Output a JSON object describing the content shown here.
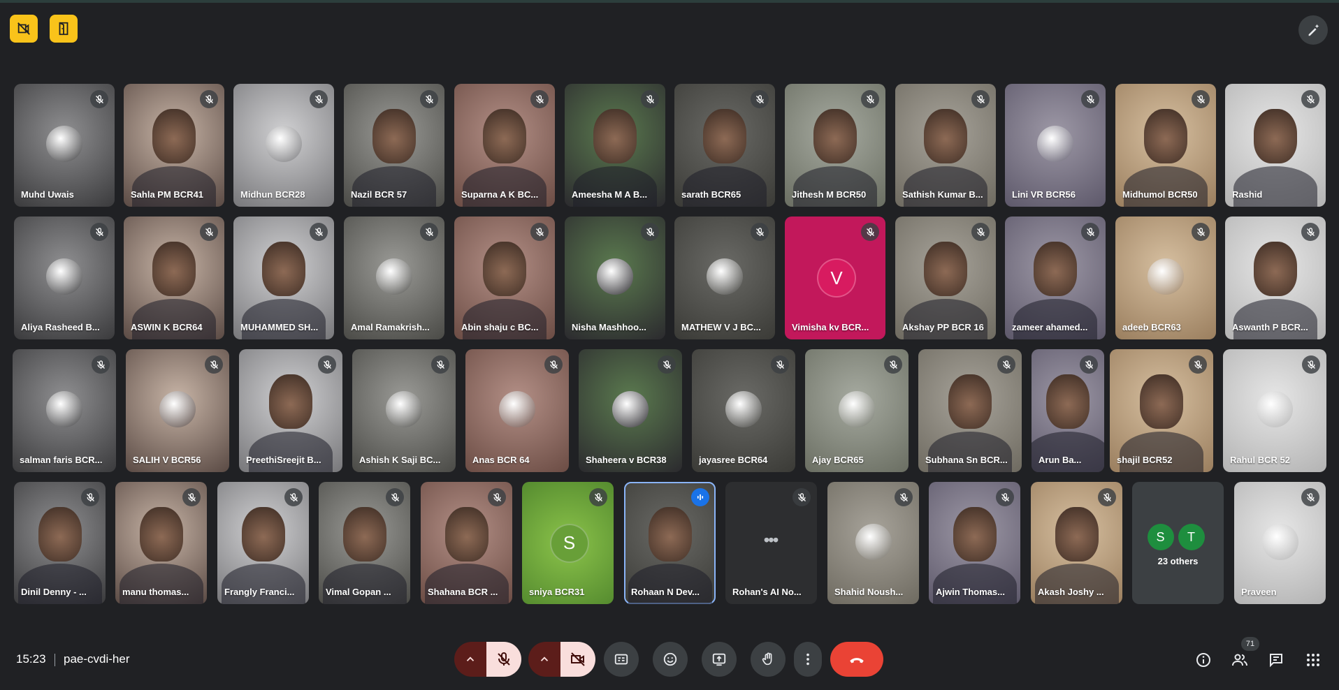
{
  "meeting": {
    "time": "15:23",
    "code": "pae-cvdi-her",
    "participant_count": "71"
  },
  "others_tile": {
    "initials": [
      "S",
      "T"
    ],
    "label": "23 others"
  },
  "colors": {
    "background": "#202124",
    "accent": "#f9c31a",
    "hangup": "#ea4335",
    "muted_red": "#f9dedc"
  },
  "participants": [
    {
      "name": "Muhd Uwais",
      "kind": "avatar"
    },
    {
      "name": "Sahla PM BCR41",
      "kind": "video"
    },
    {
      "name": "Midhun BCR28",
      "kind": "avatar"
    },
    {
      "name": "Nazil BCR 57",
      "kind": "video"
    },
    {
      "name": "Suparna A K BC...",
      "kind": "video"
    },
    {
      "name": "Ameesha M A B...",
      "kind": "video"
    },
    {
      "name": "sarath BCR65",
      "kind": "video"
    },
    {
      "name": "Jithesh M BCR50",
      "kind": "video"
    },
    {
      "name": "Sathish Kumar B...",
      "kind": "video"
    },
    {
      "name": "Lini VR BCR56",
      "kind": "avatar"
    },
    {
      "name": "Midhumol BCR50",
      "kind": "video"
    },
    {
      "name": "Rashid",
      "kind": "video"
    },
    {
      "name": "Aliya Rasheed B...",
      "kind": "avatar"
    },
    {
      "name": "ASWIN K BCR64",
      "kind": "video"
    },
    {
      "name": "MUHAMMED SH...",
      "kind": "video"
    },
    {
      "name": "Amal Ramakrish...",
      "kind": "avatar"
    },
    {
      "name": "Abin shaju c BC...",
      "kind": "video"
    },
    {
      "name": "Nisha Mashhoo...",
      "kind": "avatar"
    },
    {
      "name": "MATHEW V J BC...",
      "kind": "avatar"
    },
    {
      "name": "Vimisha kv BCR...",
      "kind": "letter",
      "letter": "V"
    },
    {
      "name": "Akshay PP BCR 16",
      "kind": "video"
    },
    {
      "name": "zameer ahamed...",
      "kind": "video"
    },
    {
      "name": "adeeb BCR63",
      "kind": "avatar"
    },
    {
      "name": "Aswanth P BCR...",
      "kind": "video"
    },
    {
      "name": "salman faris BCR...",
      "kind": "avatar"
    },
    {
      "name": "SALIH V BCR56",
      "kind": "avatar"
    },
    {
      "name": "PreethiSreejit B...",
      "kind": "video"
    },
    {
      "name": "Ashish K Saji BC...",
      "kind": "avatar"
    },
    {
      "name": "Anas BCR 64",
      "kind": "avatar"
    },
    {
      "name": "Shaheera v BCR38",
      "kind": "avatar"
    },
    {
      "name": "jayasree BCR64",
      "kind": "avatar"
    },
    {
      "name": "Ajay BCR65",
      "kind": "avatar"
    },
    {
      "name": "Subhana Sn BCR...",
      "kind": "video"
    },
    {
      "name": "Arun Ba...",
      "kind": "video"
    },
    {
      "name": "shajil BCR52",
      "kind": "video"
    },
    {
      "name": "Rahul BCR 52",
      "kind": "avatar"
    },
    {
      "name": "Dinil Denny - ...",
      "kind": "video"
    },
    {
      "name": "manu thomas...",
      "kind": "video"
    },
    {
      "name": "Frangly Franci...",
      "kind": "video"
    },
    {
      "name": "Vimal Gopan ...",
      "kind": "video"
    },
    {
      "name": "Shahana BCR ...",
      "kind": "video"
    },
    {
      "name": "sniya BCR31",
      "kind": "letter",
      "letter": "S"
    },
    {
      "name": "Rohaan N Dev...",
      "kind": "video",
      "speaking": true
    },
    {
      "name": "Rohan's AI No...",
      "kind": "bot"
    },
    {
      "name": "Shahid Noush...",
      "kind": "avatar"
    },
    {
      "name": "Ajwin Thomas...",
      "kind": "video"
    },
    {
      "name": "Akash Joshy ...",
      "kind": "video"
    },
    {
      "name": "Praveen",
      "kind": "avatar"
    }
  ]
}
